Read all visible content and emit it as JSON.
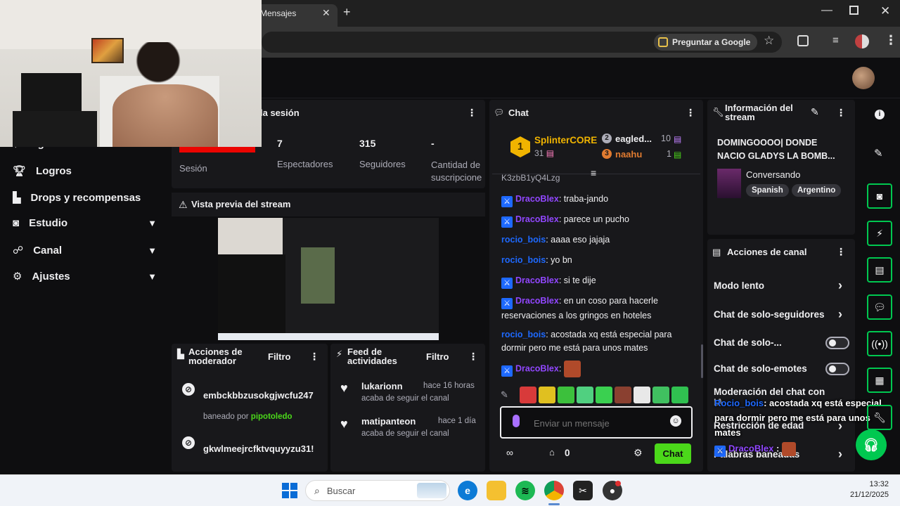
{
  "browser": {
    "tab_title": "Mensajes",
    "ask_google": "Preguntar a Google"
  },
  "sidebar": {
    "items": [
      {
        "label": "Ingresos"
      },
      {
        "label": "Logros"
      },
      {
        "label": "Drops y recompensas"
      },
      {
        "label": "Estudio"
      },
      {
        "label": "Canal"
      },
      {
        "label": "Ajustes"
      }
    ]
  },
  "session": {
    "title": "la sesión",
    "live_label": "",
    "session_label": "Sesión",
    "viewers_value": "7",
    "viewers_label": "Espectadores",
    "followers_value": "315",
    "followers_label": "Seguidores",
    "subs_value": "-",
    "subs_label": "Cantidad de suscripcione"
  },
  "preview": {
    "title": "Vista previa del stream"
  },
  "mod_actions": {
    "title": "Acciones de moderador",
    "filter": "Filtro",
    "items": [
      {
        "user": "embckbbzusokgjwcfu247",
        "detail_prefix": "baneado por",
        "by": "pipotoledo"
      },
      {
        "user": "gkwlmeejrcfktvquyyzu31!"
      }
    ]
  },
  "activity": {
    "title": "Feed de actividades",
    "filter": "Filtro",
    "items": [
      {
        "user": "lukarionn",
        "time": "hace 16 horas",
        "detail": "acaba de seguir el canal"
      },
      {
        "user": "matipanteon",
        "time": "hace 1 día",
        "detail": "acaba de seguir el canal"
      }
    ]
  },
  "chat": {
    "title": "Chat",
    "leaderboard": {
      "first": {
        "rank": "1",
        "name": "SplinterCORE",
        "amount": "31"
      },
      "second": {
        "name": "eagled...",
        "amount": "10"
      },
      "third": {
        "name": "naahu",
        "amount": "1"
      }
    },
    "cut_line": "K3zbB1yQ4Lzg",
    "messages": [
      {
        "user": "DracoBlex",
        "text": ": traba-jando"
      },
      {
        "user": "DracoBlex",
        "text": ": parece un pucho"
      },
      {
        "user": "rocio_bois",
        "text": ": aaaa eso jajaja"
      },
      {
        "user": "rocio_bois",
        "text": ": yo bn"
      },
      {
        "user": "DracoBlex",
        "text": ": si te dije"
      },
      {
        "user": "DracoBlex",
        "text": ": en un coso para hacerle reservaciones a los gringos en hoteles"
      },
      {
        "user": "rocio_bois",
        "text": ": acostada xq está especial para dormir pero me está para unos mates"
      },
      {
        "user": "DracoBlex",
        "text": ":"
      }
    ],
    "input_placeholder": "Enviar un mensaje",
    "points": "0",
    "send_label": "Chat"
  },
  "stream_info": {
    "title": "Información del stream",
    "stream_title": "DOMINGOOOO| DONDE NACIO GLADYS LA BOMB...",
    "category": "Conversando",
    "tags": [
      "Spanish",
      "Argentino"
    ]
  },
  "channel_actions": {
    "title": "Acciones de canal",
    "items": [
      {
        "label": "Modo lento"
      },
      {
        "label": "Chat de solo-seguidores"
      },
      {
        "label": "Chat de solo-..."
      },
      {
        "label": "Chat de solo-emotes"
      },
      {
        "label": "Moderación del chat con IA"
      },
      {
        "label": "Restricción de edad"
      },
      {
        "label": "Palabras baneadas"
      }
    ]
  },
  "overlay": {
    "user": "Rocio_bois",
    "text": ": acostada xq está especial para dormir pero me está para unos mates",
    "user2": "DracoBlex",
    "sep2": ":"
  },
  "taskbar": {
    "search_placeholder": "Buscar",
    "time": "13:32",
    "date": "21/12/2025"
  },
  "colors": {
    "accent_purple": "#9147ff",
    "accent_green": "#4bd81a",
    "live_red": "#eb0400",
    "link_blue": "#1e69ff"
  }
}
